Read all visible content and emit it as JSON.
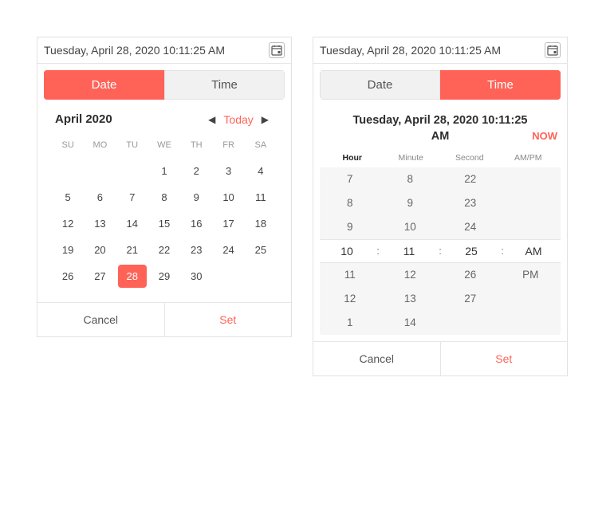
{
  "left": {
    "header": "Tuesday, April 28, 2020 10:11:25 AM",
    "tabs": {
      "date": "Date",
      "time": "Time",
      "active": "date"
    },
    "month": "April 2020",
    "today": "Today",
    "weekdays": [
      "SU",
      "MO",
      "TU",
      "WE",
      "TH",
      "FR",
      "SA"
    ],
    "rows": [
      [
        "",
        "",
        "",
        "1",
        "2",
        "3",
        "4"
      ],
      [
        "5",
        "6",
        "7",
        "8",
        "9",
        "10",
        "11"
      ],
      [
        "12",
        "13",
        "14",
        "15",
        "16",
        "17",
        "18"
      ],
      [
        "19",
        "20",
        "21",
        "22",
        "23",
        "24",
        "25"
      ],
      [
        "26",
        "27",
        "28",
        "29",
        "30",
        "",
        ""
      ]
    ],
    "selected": "28",
    "cancel": "Cancel",
    "set": "Set"
  },
  "right": {
    "header": "Tuesday, April 28, 2020 10:11:25 AM",
    "tabs": {
      "date": "Date",
      "time": "Time",
      "active": "time"
    },
    "title_line1": "Tuesday, April 28, 2020 10:11:25",
    "title_line2": "AM",
    "now": "NOW",
    "col_labels": {
      "hour": "Hour",
      "minute": "Minute",
      "second": "Second",
      "ampm": "AM/PM"
    },
    "hours": [
      "7",
      "8",
      "9",
      "10",
      "11",
      "12",
      "1"
    ],
    "minutes": [
      "8",
      "9",
      "10",
      "11",
      "12",
      "13",
      "14"
    ],
    "seconds": [
      "22",
      "23",
      "24",
      "25",
      "26",
      "27",
      ""
    ],
    "ampm": [
      "",
      "",
      "",
      "AM",
      "PM",
      "",
      ""
    ],
    "sel": {
      "hour": "10",
      "minute": "11",
      "second": "25",
      "ampm": "AM"
    },
    "cancel": "Cancel",
    "set": "Set"
  }
}
